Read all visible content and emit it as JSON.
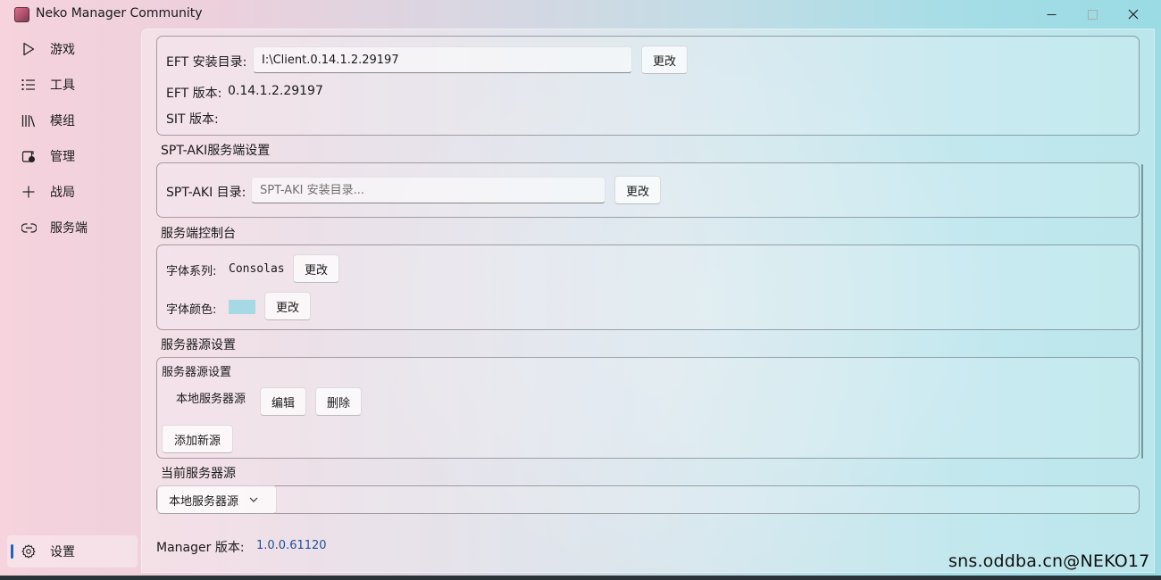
{
  "window": {
    "title": "Neko Manager Community"
  },
  "sidebar": {
    "items": [
      {
        "label": "游戏",
        "icon": "play-icon"
      },
      {
        "label": "工具",
        "icon": "list-icon"
      },
      {
        "label": "模组",
        "icon": "library-icon"
      },
      {
        "label": "管理",
        "icon": "manage-icon"
      },
      {
        "label": "战局",
        "icon": "add-icon"
      },
      {
        "label": "服务端",
        "icon": "link-icon"
      }
    ],
    "settings": {
      "label": "设置",
      "icon": "gear-icon",
      "selected": true
    }
  },
  "eft": {
    "install_dir_label": "EFT 安装目录:",
    "install_dir_value": "I:\\Client.0.14.1.2.29197",
    "change_label": "更改",
    "version_label": "EFT 版本:",
    "version_value": "0.14.1.2.29197",
    "sit_version_label": "SIT 版本:"
  },
  "spt": {
    "section_title": "SPT-AKI服务端设置",
    "dir_label": "SPT-AKI 目录:",
    "dir_placeholder": "SPT-AKI 安装目录...",
    "change_label": "更改"
  },
  "console": {
    "section_title": "服务端控制台",
    "font_family_label": "字体系列:",
    "font_family_value": "Consolas",
    "font_change_label": "更改",
    "font_color_label": "字体颜色:",
    "font_color": "#a6d9e6",
    "color_change_label": "更改"
  },
  "server_sources": {
    "section_title": "服务器源设置",
    "inner_title": "服务器源设置",
    "items": [
      {
        "name": "本地服务器源",
        "edit_label": "编辑",
        "delete_label": "删除"
      }
    ],
    "add_label": "添加新源"
  },
  "current_source": {
    "section_title": "当前服务器源",
    "selected": "本地服务器源"
  },
  "manager_version": {
    "label": "Manager 版本:",
    "value": "1.0.0.61120"
  },
  "credit": "sns.oddba.cn@NEKO17",
  "colors": {
    "accent": "#1f5fc9",
    "version_link": "#1f4f9b"
  }
}
